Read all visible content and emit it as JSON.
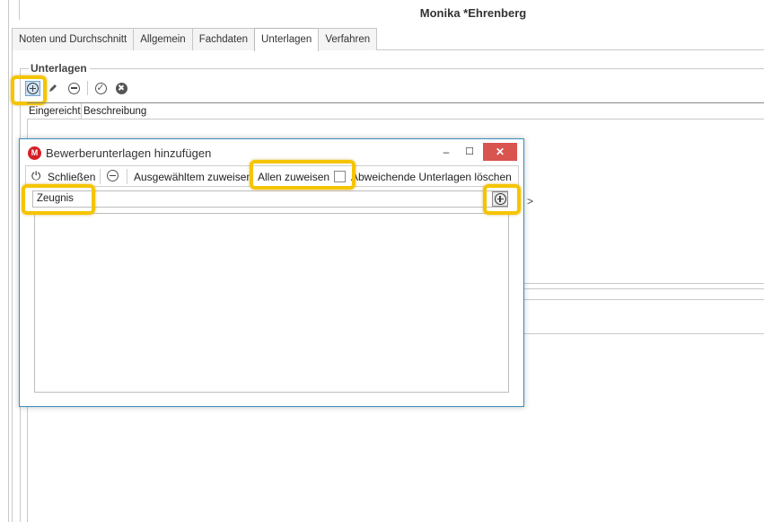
{
  "window": {
    "title": "Monika *Ehrenberg"
  },
  "tabs": [
    {
      "label": "Noten und Durchschnitt",
      "active": false
    },
    {
      "label": "Allgemein",
      "active": false
    },
    {
      "label": "Fachdaten",
      "active": false
    },
    {
      "label": "Unterlagen",
      "active": true
    },
    {
      "label": "Verfahren",
      "active": false
    }
  ],
  "unterlagen": {
    "group_label": "Unterlagen",
    "toolbar": {
      "add_icon": "plus-circle-icon",
      "edit_icon": "pencil-icon",
      "remove_icon": "minus-circle-icon",
      "confirm_icon": "check-circle-icon",
      "cancel_icon": "x-circle-icon"
    },
    "columns": [
      "Eingereicht",
      "Beschreibung"
    ],
    "partial_text": ">"
  },
  "dialog": {
    "title": "Bewerberunterlagen hinzufügen",
    "app_icon_letter": "M",
    "minimize": "–",
    "maximize": "☐",
    "close": "✕",
    "toolbar": {
      "close_label": "Schließen",
      "assign_selected_label": "Ausgewähltem zuweisen",
      "assign_all_label": "Allen zuweisen",
      "assign_all_checked": false,
      "delete_label": "Abweichende Unterlagen löschen"
    },
    "input_value": "Zeugnis"
  },
  "colors": {
    "highlight": "#f5c400",
    "close_button": "#d9534f",
    "dialog_border": "#3a8fbd",
    "app_icon": "#d61f26"
  }
}
